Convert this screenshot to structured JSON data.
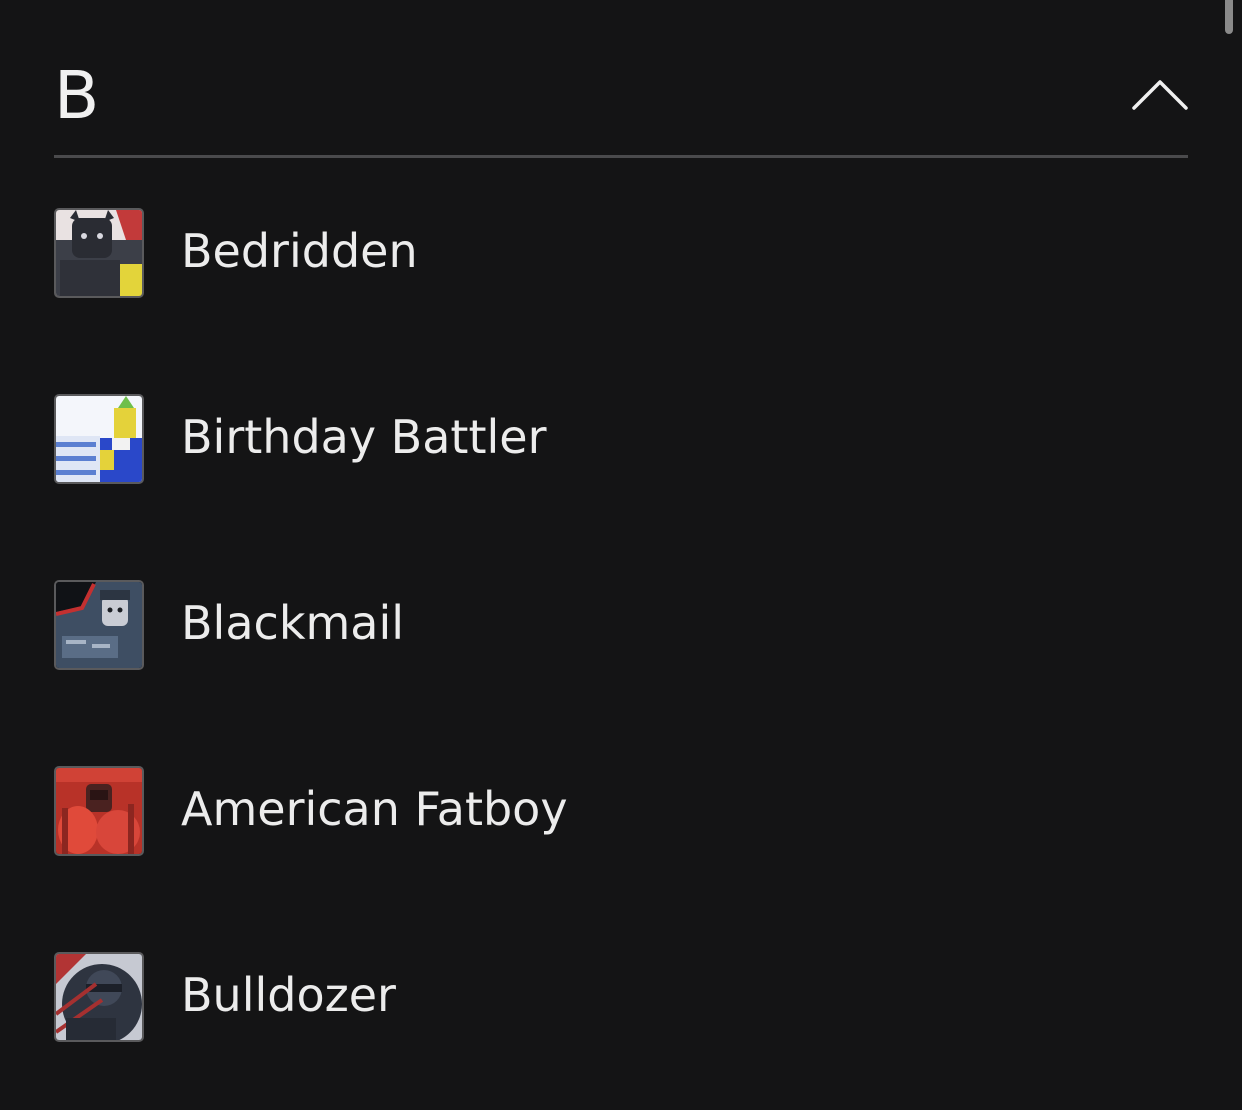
{
  "section": {
    "letter": "B",
    "toggle_icon": "chevron-up-icon"
  },
  "items": [
    {
      "label": "Bedridden",
      "thumbnail": "bedridden-thumbnail"
    },
    {
      "label": "Birthday Battler",
      "thumbnail": "birthday-battler-thumbnail"
    },
    {
      "label": "Blackmail",
      "thumbnail": "blackmail-thumbnail"
    },
    {
      "label": "American Fatboy",
      "thumbnail": "american-fatboy-thumbnail"
    },
    {
      "label": "Bulldozer",
      "thumbnail": "bulldozer-thumbnail"
    }
  ],
  "colors": {
    "background": "#141415",
    "text": "#ececec",
    "divider": "#4a4a4c"
  }
}
